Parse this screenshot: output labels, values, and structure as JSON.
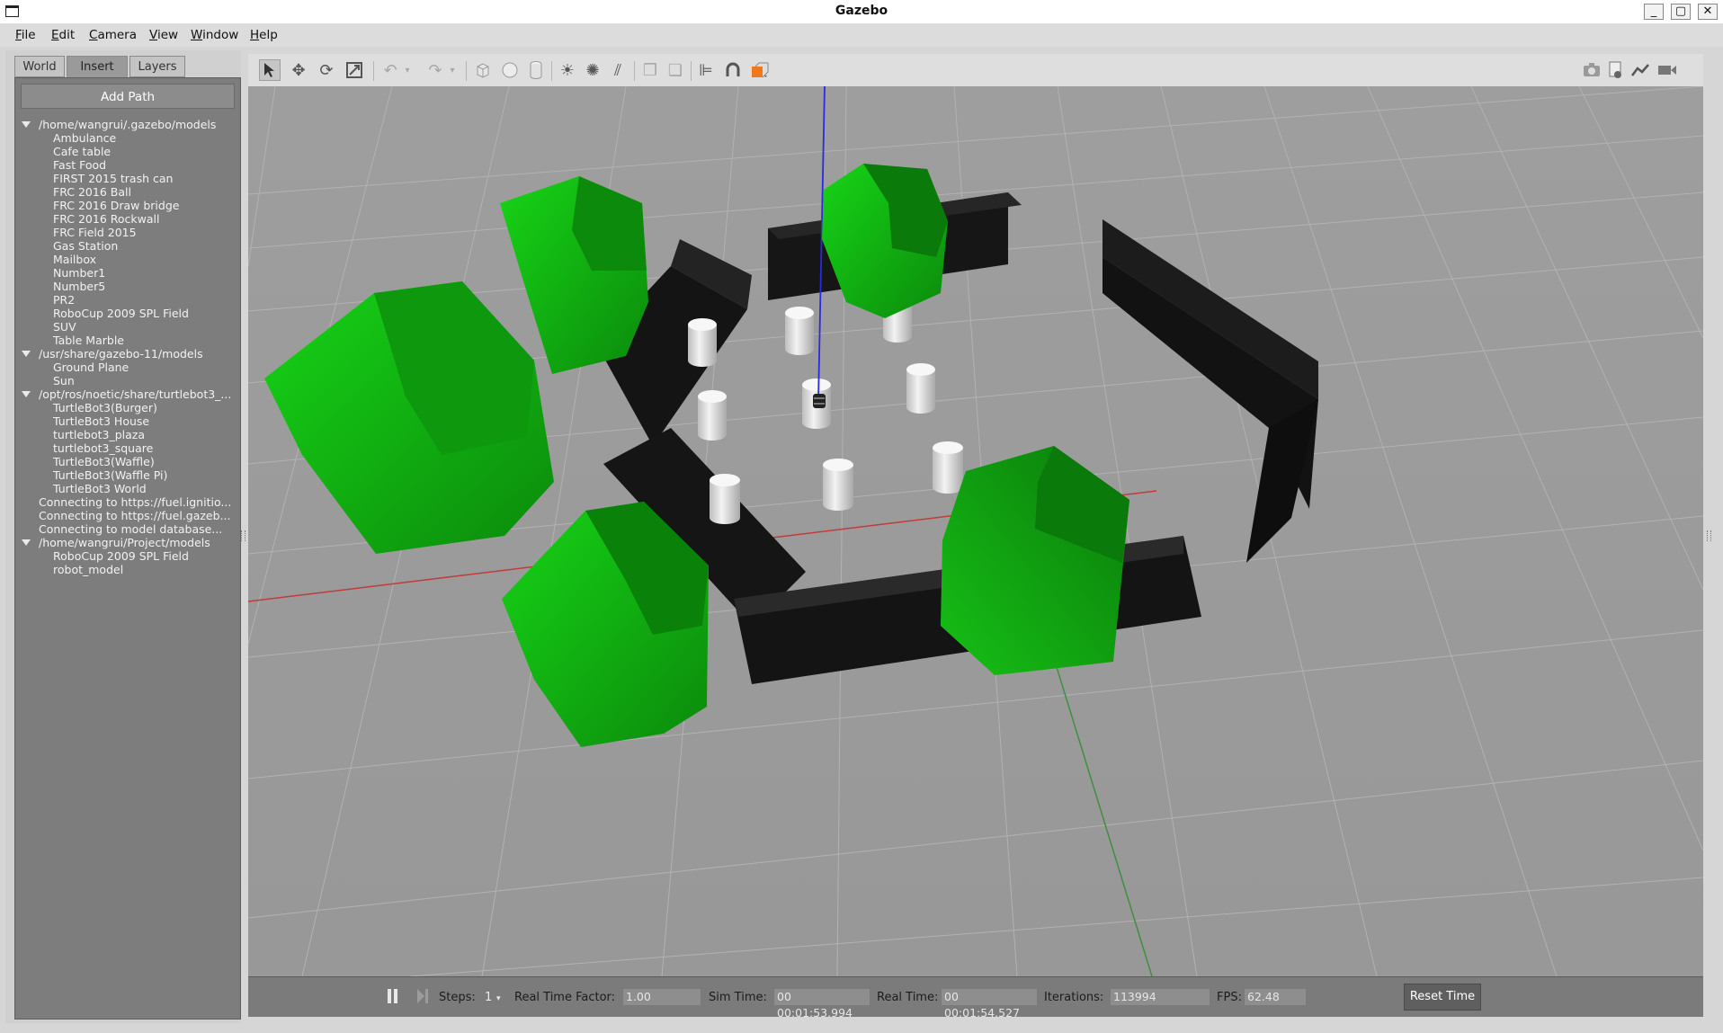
{
  "window": {
    "title": "Gazebo"
  },
  "menu": [
    "File",
    "Edit",
    "Camera",
    "View",
    "Window",
    "Help"
  ],
  "left_tabs": [
    {
      "label": "World",
      "active": false
    },
    {
      "label": "Insert",
      "active": true
    },
    {
      "label": "Layers",
      "active": false
    }
  ],
  "insert_panel": {
    "add_path_label": "Add Path",
    "groups": [
      {
        "path": "/home/wangrui/.gazebo/models",
        "items": [
          "Ambulance",
          "Cafe table",
          "Fast Food",
          "FIRST 2015 trash can",
          "FRC 2016 Ball",
          "FRC 2016 Draw bridge",
          "FRC 2016 Rockwall",
          "FRC Field 2015",
          "Gas Station",
          "Mailbox",
          "Number1",
          "Number5",
          "PR2",
          "RoboCup 2009 SPL Field",
          "SUV",
          "Table Marble"
        ]
      },
      {
        "path": "/usr/share/gazebo-11/models",
        "items": [
          "Ground Plane",
          "Sun"
        ]
      },
      {
        "path": "/opt/ros/noetic/share/turtlebot3_...",
        "items": [
          "TurtleBot3(Burger)",
          "TurtleBot3 House",
          "turtlebot3_plaza",
          "turtlebot3_square",
          "TurtleBot3(Waffle)",
          "TurtleBot3(Waffle Pi)",
          "TurtleBot3 World"
        ]
      }
    ],
    "status_lines": [
      "Connecting to https://fuel.ignitio...",
      "Connecting to https://fuel.gazeb...",
      "Connecting to model database..."
    ],
    "project_group": {
      "path": "/home/wangrui/Project/models",
      "items": [
        "RoboCup 2009 SPL Field",
        "robot_model"
      ]
    }
  },
  "toolbar": {
    "left": [
      "select-arrow-icon",
      "translate-icon",
      "rotate-icon",
      "scale-icon",
      "undo-icon",
      "undo-dropdown-icon",
      "redo-icon",
      "redo-dropdown-icon",
      "box-shape-icon",
      "sphere-shape-icon",
      "cylinder-shape-icon",
      "point-light-icon",
      "spot-light-icon",
      "directional-light-icon",
      "copy-icon",
      "paste-icon",
      "align-icon",
      "snap-magnet-icon",
      "change-view-icon"
    ],
    "right": [
      "screenshot-icon",
      "log-data-icon",
      "plot-icon",
      "record-video-icon"
    ]
  },
  "status": {
    "steps_label": "Steps:",
    "steps_value": "1",
    "rtf_label": "Real Time Factor:",
    "rtf_value": "1.00",
    "sim_time_label": "Sim Time:",
    "sim_time_value": "00 00:01:53.994",
    "real_time_label": "Real Time:",
    "real_time_value": "00 00:01:54.527",
    "iterations_label": "Iterations:",
    "iterations_value": "113994",
    "fps_label": "FPS:",
    "fps_value": "62.48",
    "reset_label": "Reset Time"
  },
  "colors": {
    "green_obstacle": "#1fbf1f",
    "wall_black": "#151515",
    "ground_grey": "#9a9a9a",
    "axis_x_red": "#c23b3b",
    "axis_z_blue": "#2a2ae0",
    "axis_y_green": "#3f8f3f"
  }
}
